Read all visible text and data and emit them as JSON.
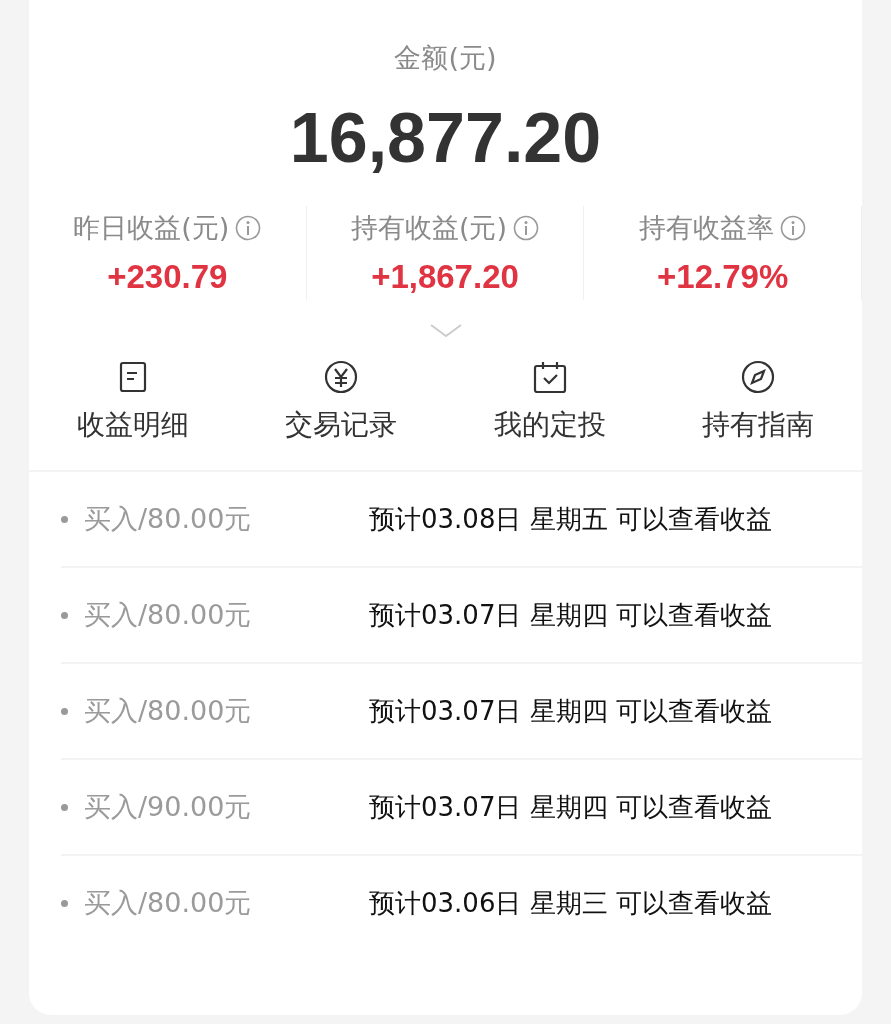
{
  "summary": {
    "label": "金额(元)",
    "amount": "16,877.20"
  },
  "stats": [
    {
      "label": "昨日收益(元)",
      "value": "+230.79"
    },
    {
      "label": "持有收益(元)",
      "value": "+1,867.20"
    },
    {
      "label": "持有收益率",
      "value": "+12.79%"
    }
  ],
  "actions": [
    {
      "kind": "document",
      "label": "收益明细"
    },
    {
      "kind": "yuan",
      "label": "交易记录"
    },
    {
      "kind": "calendar",
      "label": "我的定投"
    },
    {
      "kind": "compass",
      "label": "持有指南"
    }
  ],
  "records": [
    {
      "amount": "买入/80.00元",
      "note": "预计03.08日 星期五 可以查看收益"
    },
    {
      "amount": "买入/80.00元",
      "note": "预计03.07日 星期四 可以查看收益"
    },
    {
      "amount": "买入/80.00元",
      "note": "预计03.07日 星期四 可以查看收益"
    },
    {
      "amount": "买入/90.00元",
      "note": "预计03.07日 星期四 可以查看收益"
    },
    {
      "amount": "买入/80.00元",
      "note": "预计03.06日 星期三 可以查看收益"
    }
  ]
}
